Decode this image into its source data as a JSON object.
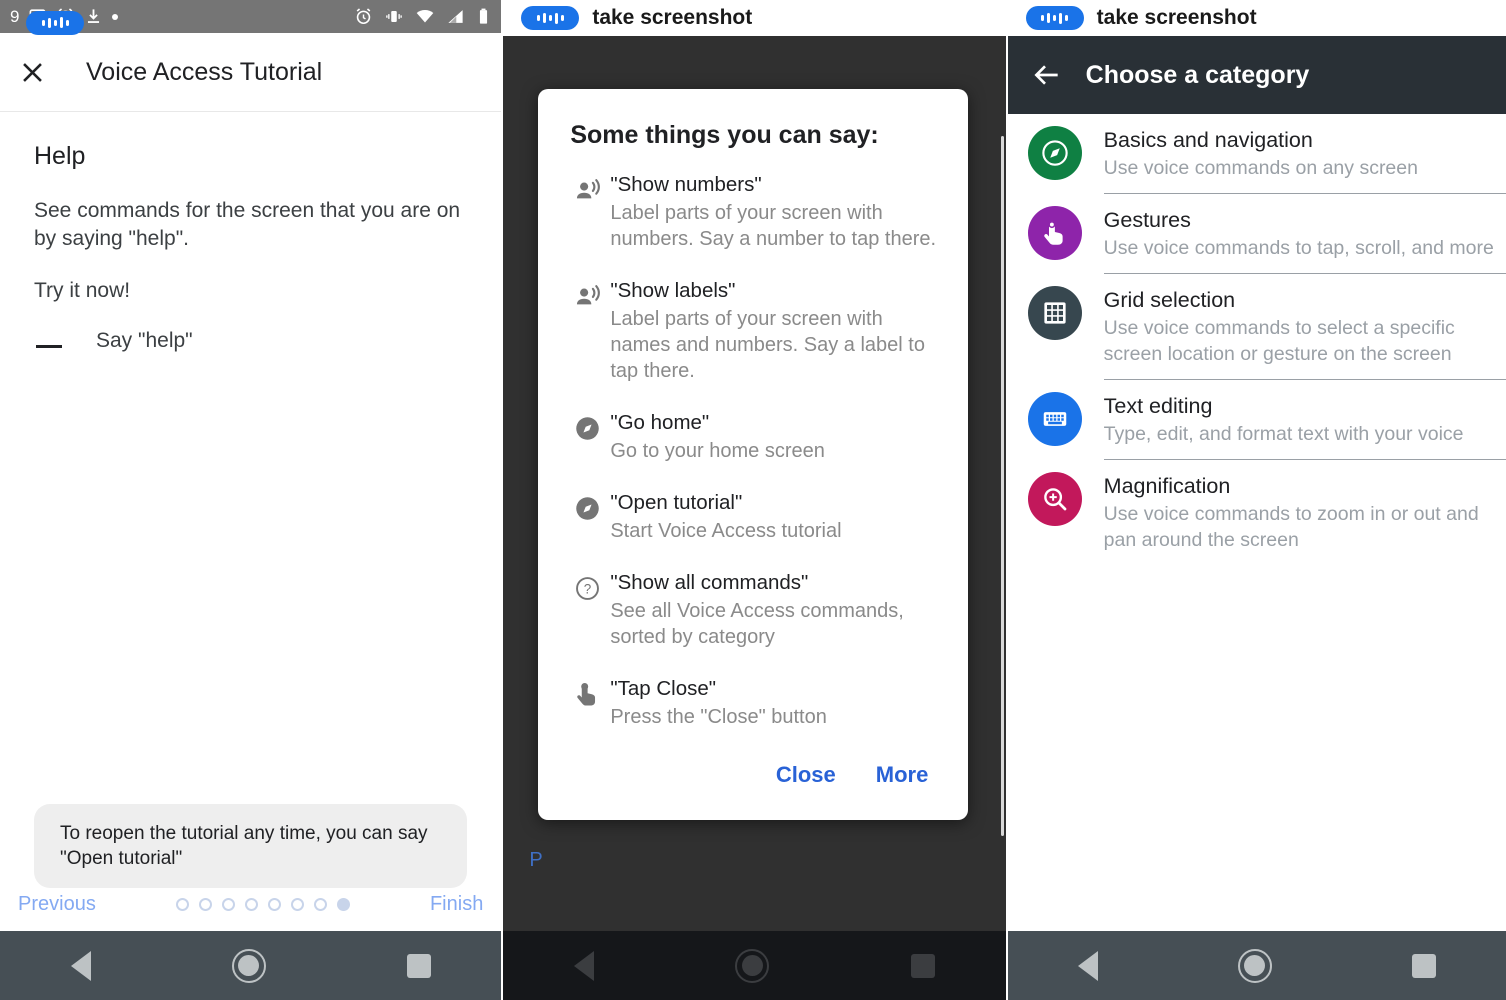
{
  "panel1": {
    "statusbar": {
      "time": "9",
      "voice_pill": "voice-access-listening",
      "left_icons": [
        "calendar-31-icon",
        "alarm-icon",
        "download-icon",
        "dot-icon"
      ],
      "right_icons": [
        "alarm-icon",
        "vibrate-icon",
        "wifi-icon",
        "signal-icon",
        "battery-icon"
      ]
    },
    "appbar": {
      "close_icon": "close-icon",
      "title": "Voice Access Tutorial"
    },
    "heading": "Help",
    "paragraph1": "See commands for the screen that you are on by saying \"help\".",
    "paragraph2": "Try it now!",
    "bullet": "Say \"help\"",
    "toast": "To reopen the tutorial any time, you can say \"Open tutorial\"",
    "pager": {
      "previous": "Previous",
      "finish": "Finish",
      "total_dots": 8,
      "active_index": 7
    }
  },
  "panel2": {
    "banner": {
      "label": "take screenshot"
    },
    "dialog": {
      "title": "Some things you can say:",
      "commands": [
        {
          "icon": "record-voice-over-icon",
          "name": "\"Show numbers\"",
          "desc": "Label parts of your screen with numbers. Say a number to tap there."
        },
        {
          "icon": "record-voice-over-icon",
          "name": "\"Show labels\"",
          "desc": "Label parts of your screen with names and numbers. Say a label to tap there."
        },
        {
          "icon": "compass-icon",
          "name": "\"Go home\"",
          "desc": "Go to your home screen"
        },
        {
          "icon": "compass-icon",
          "name": "\"Open tutorial\"",
          "desc": "Start Voice Access tutorial"
        },
        {
          "icon": "help-circle-icon",
          "name": "\"Show all commands\"",
          "desc": "See all Voice Access commands, sorted by category"
        },
        {
          "icon": "touch-gesture-icon",
          "name": "\"Tap Close\"",
          "desc": "Press the \"Close\" button"
        }
      ],
      "close_label": "Close",
      "more_label": "More"
    },
    "background_previous": "P"
  },
  "panel3": {
    "banner": {
      "label": "take screenshot"
    },
    "header": {
      "back_icon": "arrow-back-icon",
      "title": "Choose a category"
    },
    "categories": [
      {
        "icon": "compass-icon",
        "color": "#0f8043",
        "title": "Basics and navigation",
        "desc": "Use voice commands on any screen"
      },
      {
        "icon": "touch-gesture-icon",
        "color": "#8e24aa",
        "title": "Gestures",
        "desc": "Use voice commands to tap, scroll, and more"
      },
      {
        "icon": "grid-icon",
        "color": "#37474f",
        "title": "Grid selection",
        "desc": "Use voice commands to select a specific screen location or gesture on the screen"
      },
      {
        "icon": "keyboard-icon",
        "color": "#1a73e8",
        "title": "Text editing",
        "desc": "Type, edit, and format text with your voice"
      },
      {
        "icon": "zoom-in-icon",
        "color": "#c2185b",
        "title": "Magnification",
        "desc": "Use voice commands to zoom in or out and pan around the screen"
      }
    ]
  },
  "navbar": {
    "back": "back-icon",
    "home": "home-icon",
    "recents": "recents-icon"
  },
  "colors": {
    "accent_blue": "#1a73e8",
    "link_blue": "#2962d6",
    "statusbar_gray": "#757575",
    "navbar_gray": "#464f55",
    "header_dark": "#293036"
  }
}
